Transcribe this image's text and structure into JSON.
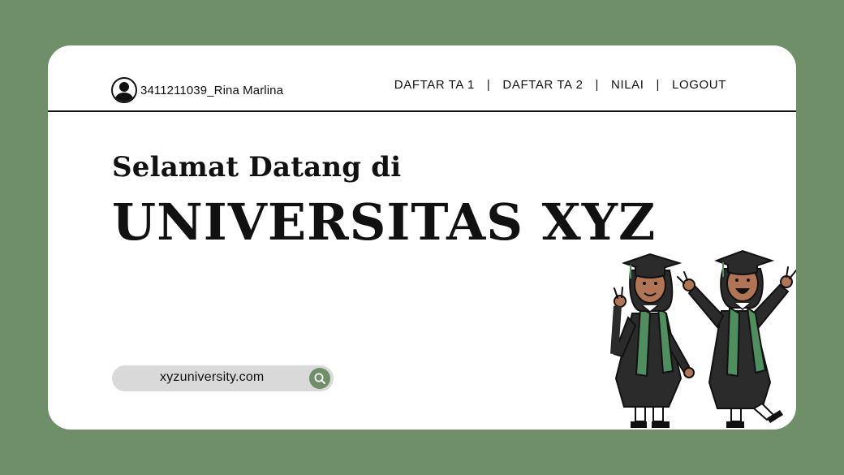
{
  "colors": {
    "background": "#6f8f69",
    "card": "#ffffff",
    "text": "#111111",
    "search_bg": "#d9d9d9",
    "accent": "#6f8f69"
  },
  "header": {
    "user_icon": "user-avatar-icon",
    "username": "3411211039_Rina Marlina",
    "nav": {
      "daftar_ta1": "DAFTAR TA 1",
      "daftar_ta2": "DAFTAR TA 2",
      "nilai": "NILAI",
      "logout": "LOGOUT",
      "separator": "|"
    }
  },
  "hero": {
    "welcome": "Selamat Datang di",
    "title": "UNIVERSITAS XYZ"
  },
  "search": {
    "text": "xyzuniversity.com",
    "icon": "search-icon"
  },
  "illustration": {
    "icon": "graduates-illustration-icon"
  }
}
